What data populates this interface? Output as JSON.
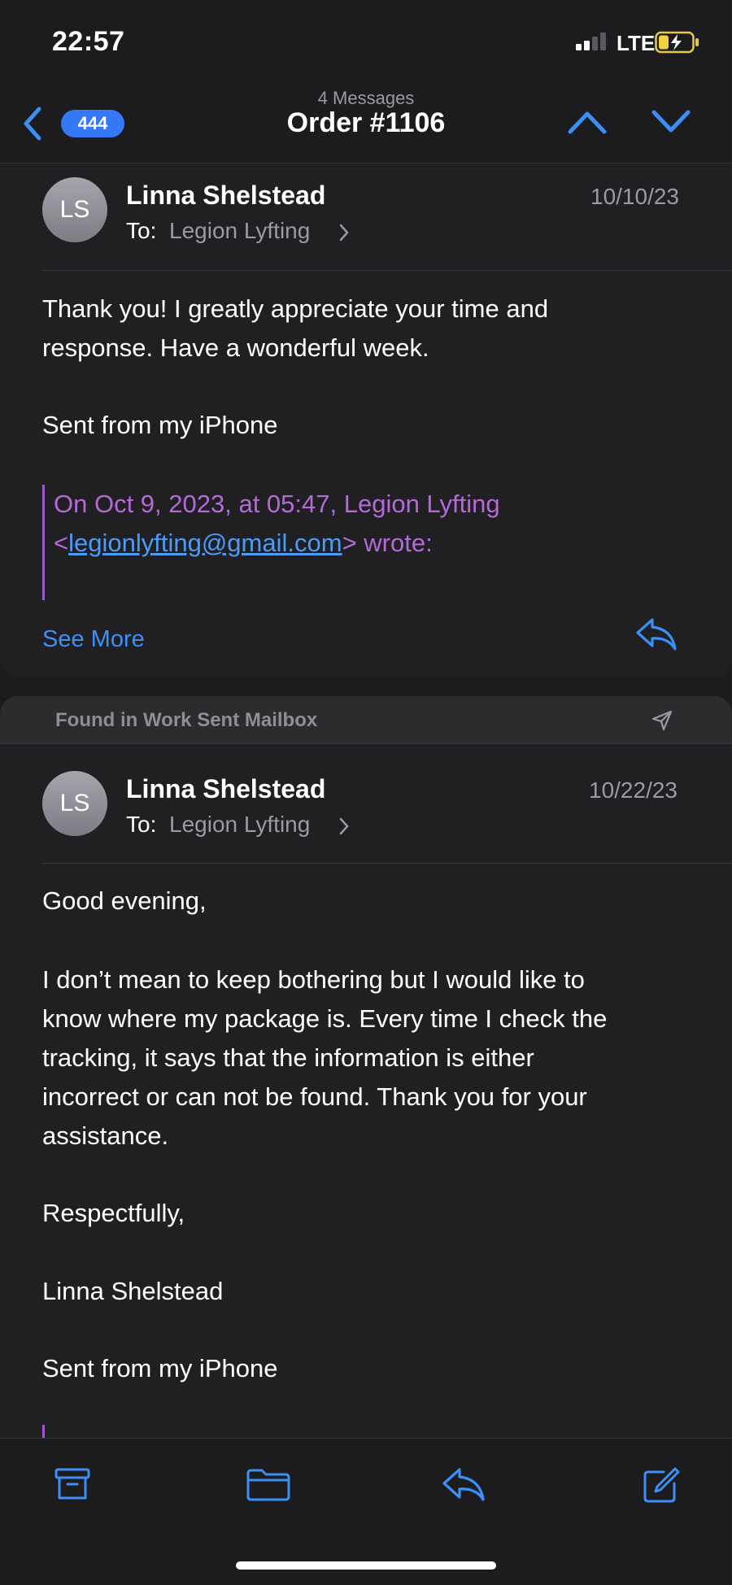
{
  "status_bar": {
    "time": "22:57",
    "network": "LTE"
  },
  "nav": {
    "unread_count": "444",
    "subtitle": "4 Messages",
    "title": "Order #1106"
  },
  "messages": [
    {
      "initials": "LS",
      "sender": "Linna Shelstead",
      "to_label": "To:",
      "to_name": "Legion Lyfting",
      "date": "10/10/23",
      "body": [
        "Thank you! I greatly appreciate your time and",
        "response. Have a wonderful week.",
        "Sent from my iPhone"
      ],
      "quote": {
        "line1": "On Oct 9, 2023, at 05:47, Legion Lyfting",
        "open": "<",
        "email": "legionlyfting@gmail.com",
        "close": "> wrote:"
      },
      "see_more": "See More"
    },
    {
      "initials": "LS",
      "sender": "Linna Shelstead",
      "to_label": "To:",
      "to_name": "Legion Lyfting",
      "date": "10/22/23",
      "body": [
        "Good evening,",
        "I don’t mean to keep bothering but I would like to",
        "know where my package is. Every time I check the",
        "tracking, it says that the information is either",
        "incorrect or can not be found. Thank you for your",
        "assistance.",
        "Respectfully,",
        "Linna Shelstead",
        "Sent from my iPhone"
      ]
    }
  ],
  "mailbox_note": "Found in Work Sent Mailbox",
  "toolbar": {
    "archive": "archive-icon",
    "move": "folder-icon",
    "reply": "reply-icon",
    "compose": "compose-icon"
  },
  "colors": {
    "accent": "#3d8ff5",
    "quote": "#b36ad8",
    "background": "#1c1c1e",
    "card": "#202023"
  }
}
